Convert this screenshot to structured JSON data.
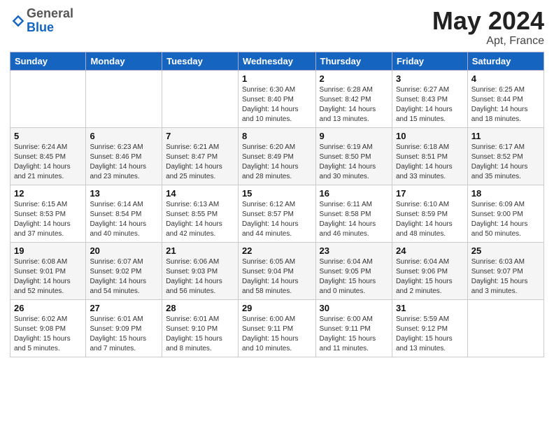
{
  "header": {
    "logo_general": "General",
    "logo_blue": "Blue",
    "title": "May 2024",
    "location": "Apt, France"
  },
  "weekdays": [
    "Sunday",
    "Monday",
    "Tuesday",
    "Wednesday",
    "Thursday",
    "Friday",
    "Saturday"
  ],
  "weeks": [
    [
      {
        "day": "",
        "info": ""
      },
      {
        "day": "",
        "info": ""
      },
      {
        "day": "",
        "info": ""
      },
      {
        "day": "1",
        "info": "Sunrise: 6:30 AM\nSunset: 8:40 PM\nDaylight: 14 hours\nand 10 minutes."
      },
      {
        "day": "2",
        "info": "Sunrise: 6:28 AM\nSunset: 8:42 PM\nDaylight: 14 hours\nand 13 minutes."
      },
      {
        "day": "3",
        "info": "Sunrise: 6:27 AM\nSunset: 8:43 PM\nDaylight: 14 hours\nand 15 minutes."
      },
      {
        "day": "4",
        "info": "Sunrise: 6:25 AM\nSunset: 8:44 PM\nDaylight: 14 hours\nand 18 minutes."
      }
    ],
    [
      {
        "day": "5",
        "info": "Sunrise: 6:24 AM\nSunset: 8:45 PM\nDaylight: 14 hours\nand 21 minutes."
      },
      {
        "day": "6",
        "info": "Sunrise: 6:23 AM\nSunset: 8:46 PM\nDaylight: 14 hours\nand 23 minutes."
      },
      {
        "day": "7",
        "info": "Sunrise: 6:21 AM\nSunset: 8:47 PM\nDaylight: 14 hours\nand 25 minutes."
      },
      {
        "day": "8",
        "info": "Sunrise: 6:20 AM\nSunset: 8:49 PM\nDaylight: 14 hours\nand 28 minutes."
      },
      {
        "day": "9",
        "info": "Sunrise: 6:19 AM\nSunset: 8:50 PM\nDaylight: 14 hours\nand 30 minutes."
      },
      {
        "day": "10",
        "info": "Sunrise: 6:18 AM\nSunset: 8:51 PM\nDaylight: 14 hours\nand 33 minutes."
      },
      {
        "day": "11",
        "info": "Sunrise: 6:17 AM\nSunset: 8:52 PM\nDaylight: 14 hours\nand 35 minutes."
      }
    ],
    [
      {
        "day": "12",
        "info": "Sunrise: 6:15 AM\nSunset: 8:53 PM\nDaylight: 14 hours\nand 37 minutes."
      },
      {
        "day": "13",
        "info": "Sunrise: 6:14 AM\nSunset: 8:54 PM\nDaylight: 14 hours\nand 40 minutes."
      },
      {
        "day": "14",
        "info": "Sunrise: 6:13 AM\nSunset: 8:55 PM\nDaylight: 14 hours\nand 42 minutes."
      },
      {
        "day": "15",
        "info": "Sunrise: 6:12 AM\nSunset: 8:57 PM\nDaylight: 14 hours\nand 44 minutes."
      },
      {
        "day": "16",
        "info": "Sunrise: 6:11 AM\nSunset: 8:58 PM\nDaylight: 14 hours\nand 46 minutes."
      },
      {
        "day": "17",
        "info": "Sunrise: 6:10 AM\nSunset: 8:59 PM\nDaylight: 14 hours\nand 48 minutes."
      },
      {
        "day": "18",
        "info": "Sunrise: 6:09 AM\nSunset: 9:00 PM\nDaylight: 14 hours\nand 50 minutes."
      }
    ],
    [
      {
        "day": "19",
        "info": "Sunrise: 6:08 AM\nSunset: 9:01 PM\nDaylight: 14 hours\nand 52 minutes."
      },
      {
        "day": "20",
        "info": "Sunrise: 6:07 AM\nSunset: 9:02 PM\nDaylight: 14 hours\nand 54 minutes."
      },
      {
        "day": "21",
        "info": "Sunrise: 6:06 AM\nSunset: 9:03 PM\nDaylight: 14 hours\nand 56 minutes."
      },
      {
        "day": "22",
        "info": "Sunrise: 6:05 AM\nSunset: 9:04 PM\nDaylight: 14 hours\nand 58 minutes."
      },
      {
        "day": "23",
        "info": "Sunrise: 6:04 AM\nSunset: 9:05 PM\nDaylight: 15 hours\nand 0 minutes."
      },
      {
        "day": "24",
        "info": "Sunrise: 6:04 AM\nSunset: 9:06 PM\nDaylight: 15 hours\nand 2 minutes."
      },
      {
        "day": "25",
        "info": "Sunrise: 6:03 AM\nSunset: 9:07 PM\nDaylight: 15 hours\nand 3 minutes."
      }
    ],
    [
      {
        "day": "26",
        "info": "Sunrise: 6:02 AM\nSunset: 9:08 PM\nDaylight: 15 hours\nand 5 minutes."
      },
      {
        "day": "27",
        "info": "Sunrise: 6:01 AM\nSunset: 9:09 PM\nDaylight: 15 hours\nand 7 minutes."
      },
      {
        "day": "28",
        "info": "Sunrise: 6:01 AM\nSunset: 9:10 PM\nDaylight: 15 hours\nand 8 minutes."
      },
      {
        "day": "29",
        "info": "Sunrise: 6:00 AM\nSunset: 9:11 PM\nDaylight: 15 hours\nand 10 minutes."
      },
      {
        "day": "30",
        "info": "Sunrise: 6:00 AM\nSunset: 9:11 PM\nDaylight: 15 hours\nand 11 minutes."
      },
      {
        "day": "31",
        "info": "Sunrise: 5:59 AM\nSunset: 9:12 PM\nDaylight: 15 hours\nand 13 minutes."
      },
      {
        "day": "",
        "info": ""
      }
    ]
  ]
}
